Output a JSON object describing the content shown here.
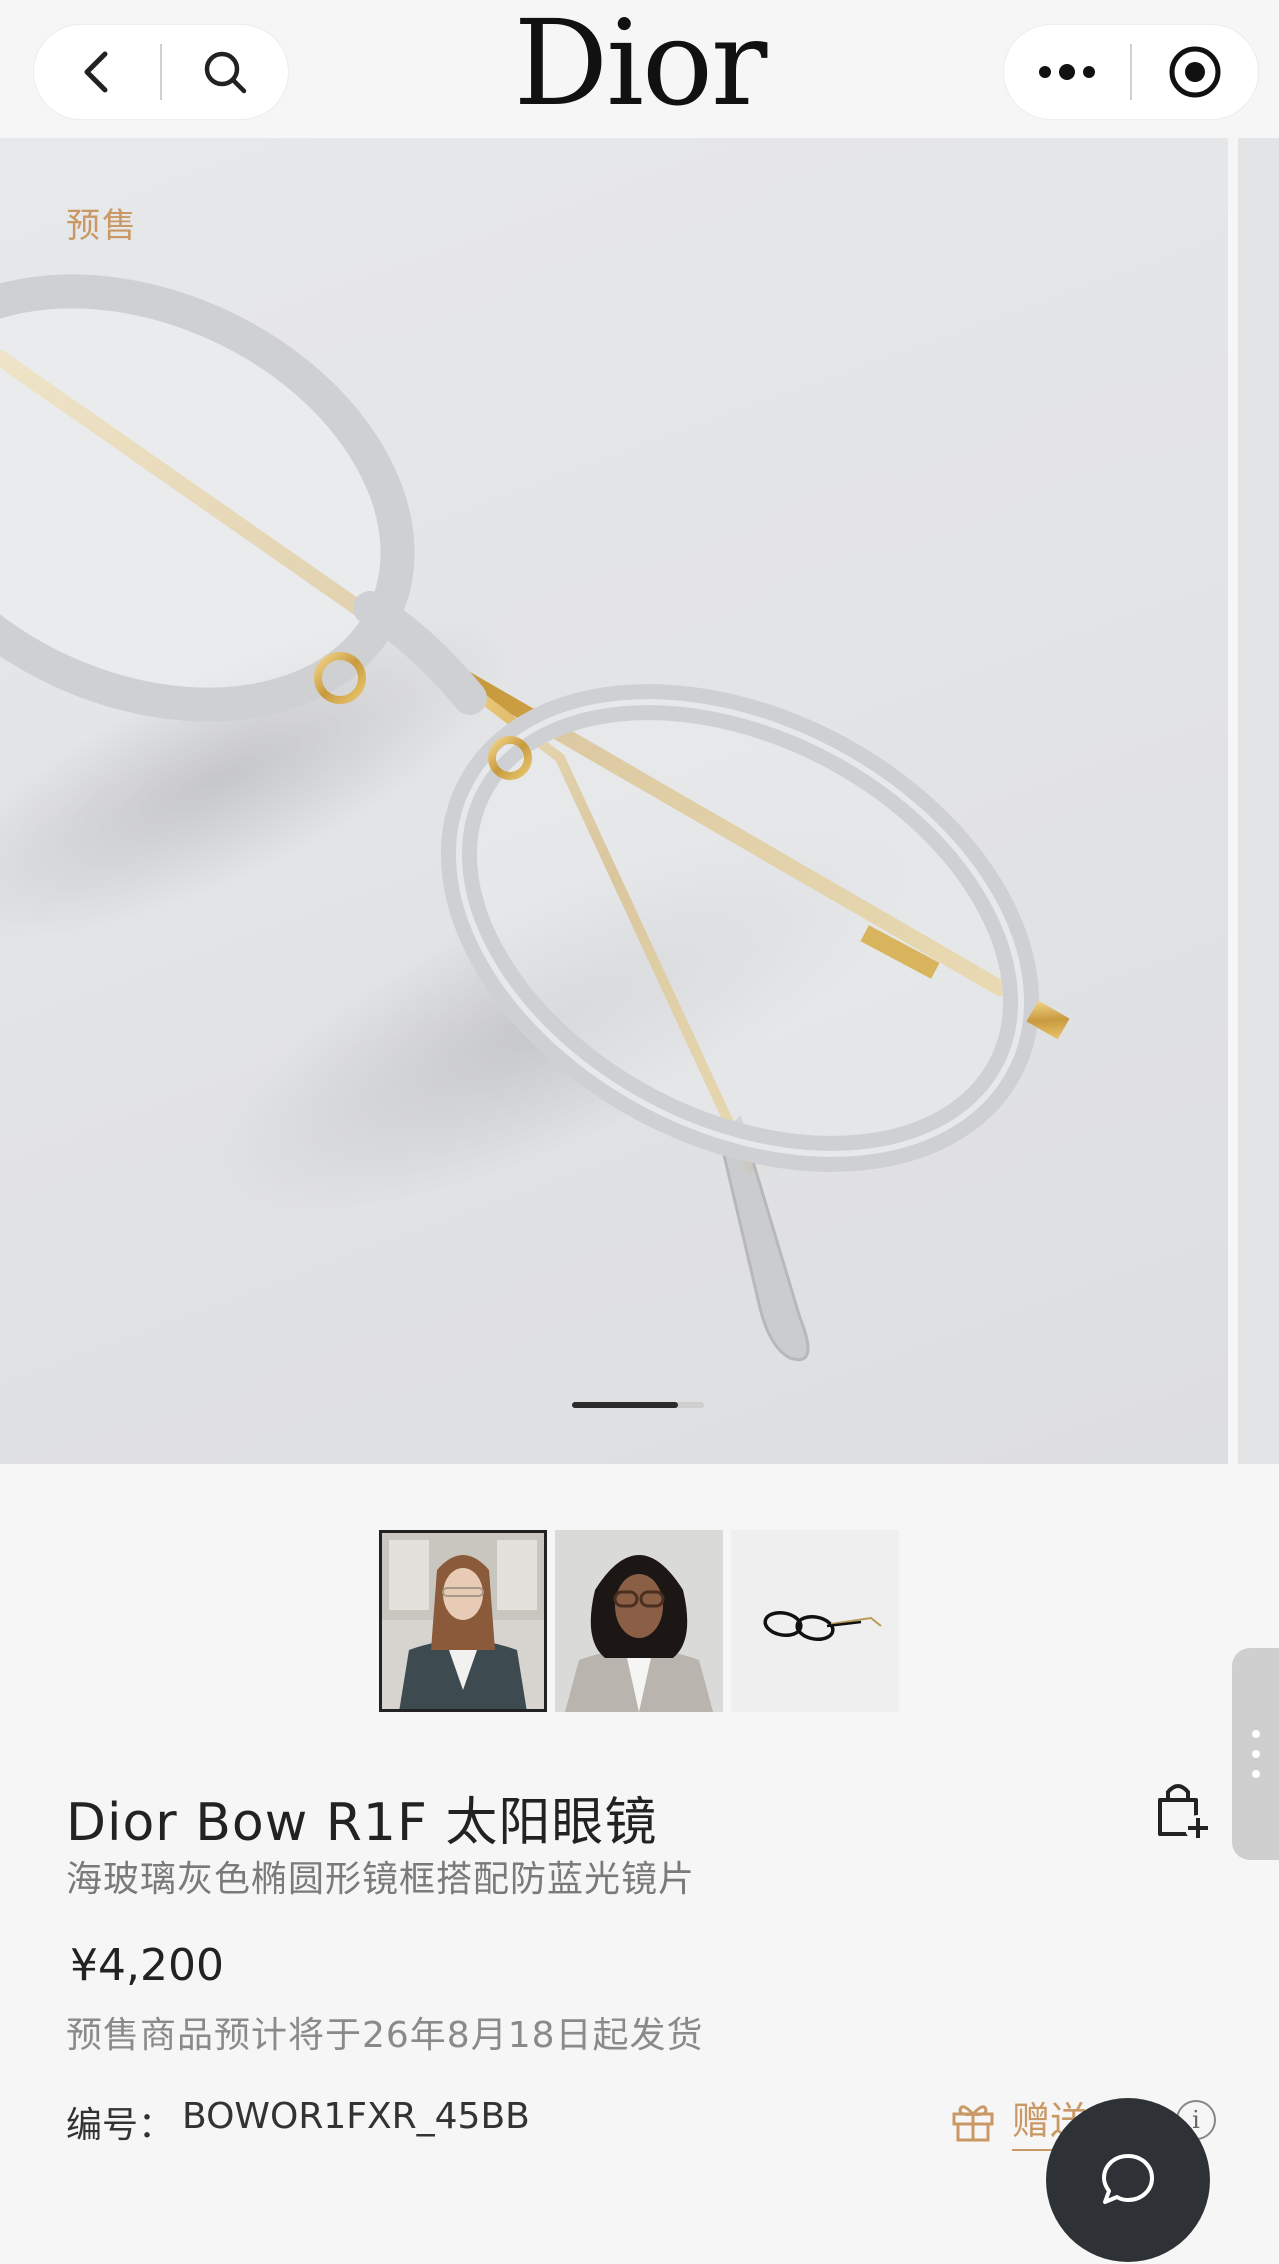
{
  "header": {
    "brand": "Dior",
    "back_icon": "chevron-left-icon",
    "search_icon": "search-icon",
    "more_icon": "more-dots-icon",
    "target_icon": "target-icon"
  },
  "gallery": {
    "tag": "预售",
    "slide_count": 2,
    "active_slide": 1,
    "thumbnails": [
      "model-wearing-denim",
      "model-wearing-blazer",
      "glasses-product-shot"
    ]
  },
  "product": {
    "title": "Dior Bow R1F 太阳眼镜",
    "subtitle": "海玻璃灰色椭圆形镜框搭配防蓝光镜片",
    "price": "¥4,200",
    "shipping_note": "预售商品预计将于26年8月18日起发货",
    "sku_label": "编号：",
    "sku_value": "BOWOR1FXR_45BB",
    "gift_label": "赠送",
    "cart_icon": "add-to-bag-icon",
    "gift_icon": "gift-icon",
    "info_icon": "info-icon",
    "info_glyph": "i"
  },
  "chat": {
    "icon": "chat-bubble-icon"
  },
  "colors": {
    "accent": "#c99865",
    "fab": "#2e3236",
    "page_bg": "#f6f6f6"
  }
}
